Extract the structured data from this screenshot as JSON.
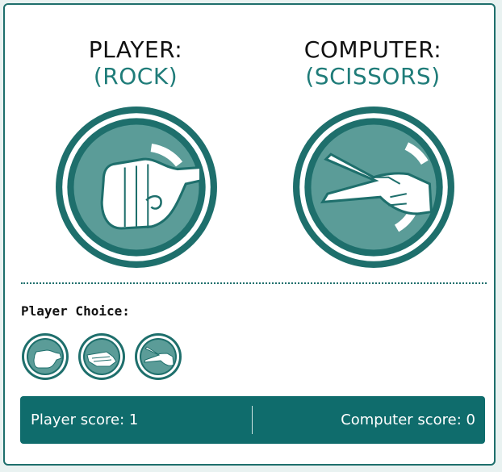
{
  "player": {
    "heading": "PLAYER:",
    "choice": "(ROCK)",
    "icon": "rock-hand-icon"
  },
  "computer": {
    "heading": "COMPUTER:",
    "choice": "(SCISSORS)",
    "icon": "scissors-hand-icon"
  },
  "choices": {
    "label": "Player Choice:",
    "options": [
      {
        "name": "rock",
        "icon": "rock-hand-icon"
      },
      {
        "name": "paper",
        "icon": "paper-hand-icon"
      },
      {
        "name": "scissors",
        "icon": "scissors-hand-icon"
      }
    ]
  },
  "score": {
    "player_text": "Player score: 1",
    "computer_text": "Computer score: 0"
  },
  "colors": {
    "accent": "#1e6f6c",
    "icon_fill": "#5b9c98",
    "bar": "#0f6c6c"
  }
}
